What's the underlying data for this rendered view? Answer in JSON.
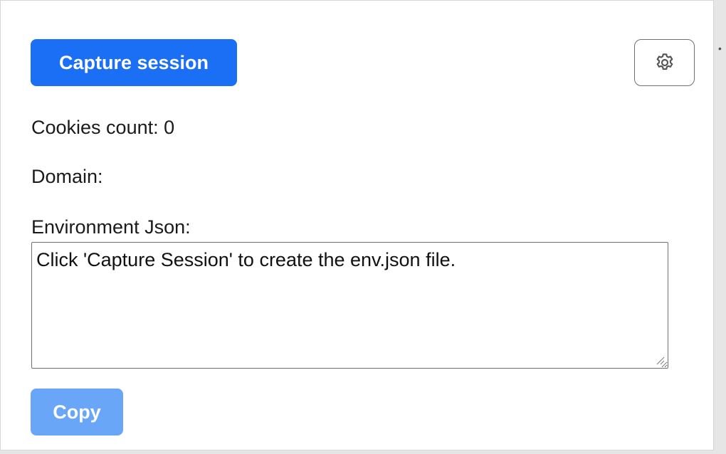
{
  "popup": {
    "capture_button_label": "Capture session",
    "settings_icon": "gear-icon",
    "cookies_label": "Cookies count:",
    "cookies_count": "0",
    "domain_label": "Domain:",
    "domain_value": "",
    "env_json_label": "Environment Json:",
    "env_json_value": "Click 'Capture Session' to create the env.json file.",
    "copy_button_label": "Copy"
  },
  "colors": {
    "primary": "#1a6ff5",
    "primary_disabled": "#6aa6f7",
    "border": "#707070",
    "text": "#1a1a1a"
  }
}
